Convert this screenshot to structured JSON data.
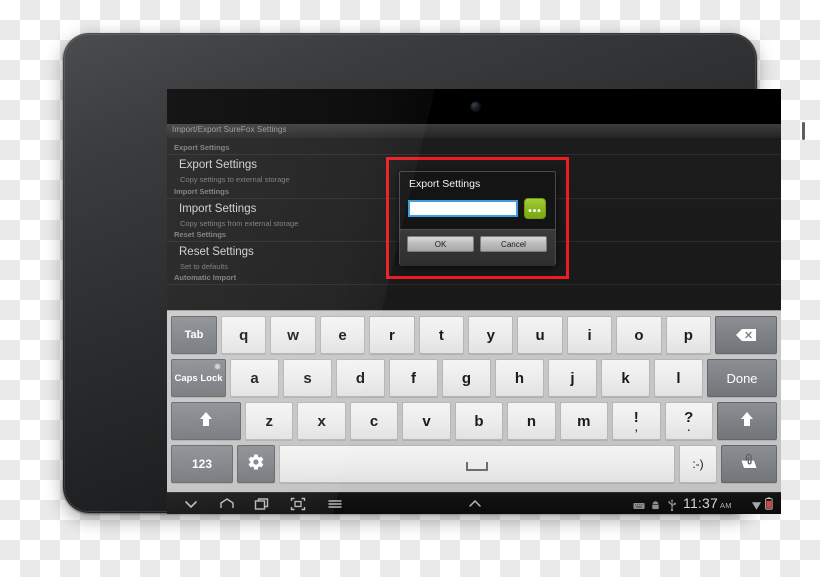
{
  "device": {
    "name": "android-tablet",
    "camera_icon": "camera-lens",
    "indicator_icon": "led-indicator"
  },
  "app": {
    "title": "Import/Export SureFox Settings",
    "sections": [
      {
        "header": "Export Settings",
        "pref_title": "Export Settings",
        "pref_subtitle": "Copy settings to external storage"
      },
      {
        "header": "Import Settings",
        "pref_title": "Import Settings",
        "pref_subtitle": "Copy settings from external storage"
      },
      {
        "header": "Reset Settings",
        "pref_title": "Reset Settings",
        "pref_subtitle": "Set to defaults"
      },
      {
        "header": "Automatic Import",
        "pref_title": "",
        "pref_subtitle": ""
      }
    ]
  },
  "dialog": {
    "title": "Export Settings",
    "input_value": "",
    "input_placeholder": "",
    "browse_label": "•••",
    "browse_icon": "ellipsis-browse-icon",
    "ok_label": "OK",
    "cancel_label": "Cancel",
    "highlight_color": "#ec1c24",
    "browse_color": "#8cba1e",
    "focus_color": "#3b9fe0"
  },
  "keyboard": {
    "row1": [
      {
        "label": "Tab",
        "style": "tab dark small-label",
        "icon": "tab-key"
      },
      {
        "label": "q",
        "style": "",
        "icon": "key-q"
      },
      {
        "label": "w",
        "style": "",
        "icon": "key-w"
      },
      {
        "label": "e",
        "style": "",
        "icon": "key-e"
      },
      {
        "label": "r",
        "style": "",
        "icon": "key-r"
      },
      {
        "label": "t",
        "style": "",
        "icon": "key-t"
      },
      {
        "label": "y",
        "style": "",
        "icon": "key-y"
      },
      {
        "label": "u",
        "style": "",
        "icon": "key-u"
      },
      {
        "label": "i",
        "style": "",
        "icon": "key-i"
      },
      {
        "label": "o",
        "style": "",
        "icon": "key-o"
      },
      {
        "label": "p",
        "style": "",
        "icon": "key-p"
      },
      {
        "label": "",
        "style": "backspace dark",
        "icon": "backspace-icon"
      }
    ],
    "row2": [
      {
        "label": "Caps Lock",
        "style": "caps dark small-label",
        "icon": "caps-lock-key"
      },
      {
        "label": "a",
        "style": "",
        "icon": "key-a"
      },
      {
        "label": "s",
        "style": "",
        "icon": "key-s"
      },
      {
        "label": "d",
        "style": "",
        "icon": "key-d"
      },
      {
        "label": "f",
        "style": "",
        "icon": "key-f"
      },
      {
        "label": "g",
        "style": "",
        "icon": "key-g"
      },
      {
        "label": "h",
        "style": "",
        "icon": "key-h"
      },
      {
        "label": "j",
        "style": "",
        "icon": "key-j"
      },
      {
        "label": "k",
        "style": "",
        "icon": "key-k"
      },
      {
        "label": "l",
        "style": "",
        "icon": "key-l"
      },
      {
        "label": "Done",
        "style": "done dark",
        "icon": "done-key"
      }
    ],
    "row3": [
      {
        "label": "",
        "style": "shift-l dark",
        "icon": "shift-up-arrow-icon"
      },
      {
        "label": "z",
        "style": "",
        "icon": "key-z"
      },
      {
        "label": "x",
        "style": "",
        "icon": "key-x"
      },
      {
        "label": "c",
        "style": "",
        "icon": "key-c"
      },
      {
        "label": "v",
        "style": "",
        "icon": "key-v"
      },
      {
        "label": "b",
        "style": "",
        "icon": "key-b"
      },
      {
        "label": "n",
        "style": "",
        "icon": "key-n"
      },
      {
        "label": "m",
        "style": "",
        "icon": "key-m"
      },
      {
        "label": "!",
        "sub": ",",
        "style": "",
        "icon": "key-exclamation"
      },
      {
        "label": "?",
        "sub": ".",
        "style": "",
        "icon": "key-question"
      },
      {
        "label": "",
        "style": "shift-r dark",
        "icon": "shift-up-arrow-icon"
      }
    ],
    "row4": [
      {
        "label": "123",
        "style": "num dark",
        "icon": "numeric-mode-key"
      },
      {
        "label": "",
        "style": "gear dark",
        "icon": "gear-icon"
      },
      {
        "label": "",
        "style": "space",
        "icon": "spacebar"
      },
      {
        "label": ":-)",
        "style": "smiley",
        "icon": "emoji-key"
      },
      {
        "label": "",
        "style": "attach dark",
        "icon": "attachment-paperclip-icon"
      }
    ]
  },
  "navbar": {
    "hide_keyboard_icon": "chevron-down-icon",
    "home_icon": "home-icon",
    "recent_apps_icon": "recent-apps-icon",
    "fullscreen_icon": "fullscreen-icon",
    "menu_icon": "menu-icon",
    "expand_up_icon": "chevron-up-icon"
  },
  "status": {
    "keyboard_icon": "keyboard-status-icon",
    "android_icon": "android-icon",
    "usb_icon": "usb-icon",
    "time": "11:37",
    "ampm": "AM",
    "wifi_icon": "wifi-icon",
    "battery_icon": "battery-icon"
  }
}
